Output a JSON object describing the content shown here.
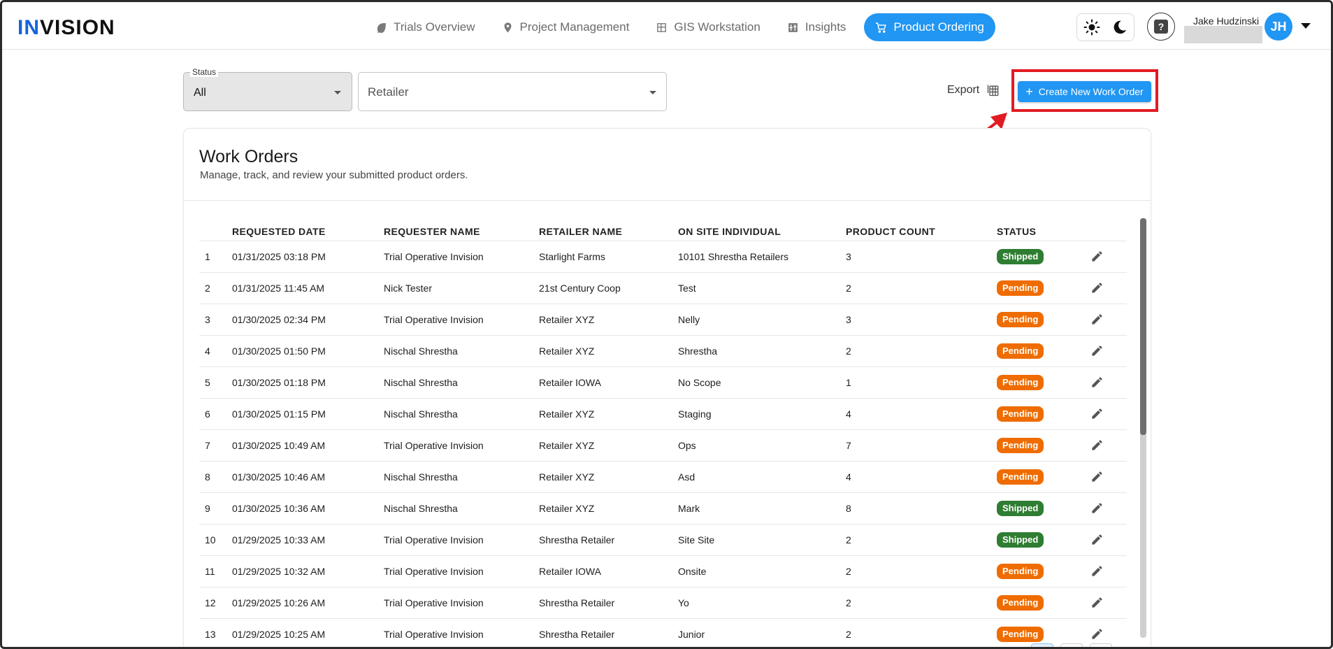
{
  "brand": {
    "logo_text": "INVISION",
    "accent": "#2196f3"
  },
  "nav": [
    {
      "label": "Trials Overview",
      "icon": "leaf-icon",
      "active": false
    },
    {
      "label": "Project Management",
      "icon": "location-settings-icon",
      "active": false
    },
    {
      "label": "GIS Workstation",
      "icon": "grid-icon",
      "active": false
    },
    {
      "label": "Insights",
      "icon": "sliders-icon",
      "active": false
    },
    {
      "label": "Product Ordering",
      "icon": "cart-icon",
      "active": true
    }
  ],
  "header": {
    "help_label": "?",
    "user_name": "Jake Hudzinski",
    "avatar_initials": "JH"
  },
  "filters": {
    "status_legend": "Status",
    "status_value": "All",
    "retailer_placeholder": "Retailer"
  },
  "actions": {
    "export_label": "Export",
    "create_label": "Create New Work Order",
    "create_plus": "+"
  },
  "card": {
    "title": "Work Orders",
    "subtitle": "Manage, track, and review your submitted product orders."
  },
  "table": {
    "columns": [
      "",
      "REQUESTED DATE",
      "REQUESTER NAME",
      "RETAILER NAME",
      "ON SITE INDIVIDUAL",
      "PRODUCT COUNT",
      "STATUS",
      ""
    ],
    "rows": [
      {
        "n": "1",
        "date": "01/31/2025 03:18 PM",
        "requester": "Trial Operative Invision",
        "retailer": "Starlight Farms",
        "onsite": "10101 Shrestha Retailers",
        "count": "3",
        "status": "Shipped"
      },
      {
        "n": "2",
        "date": "01/31/2025 11:45 AM",
        "requester": "Nick Tester",
        "retailer": "21st Century Coop",
        "onsite": "Test",
        "count": "2",
        "status": "Pending"
      },
      {
        "n": "3",
        "date": "01/30/2025 02:34 PM",
        "requester": "Trial Operative Invision",
        "retailer": "Retailer XYZ",
        "onsite": "Nelly",
        "count": "3",
        "status": "Pending"
      },
      {
        "n": "4",
        "date": "01/30/2025 01:50 PM",
        "requester": "Nischal Shrestha",
        "retailer": "Retailer XYZ",
        "onsite": "Shrestha",
        "count": "2",
        "status": "Pending"
      },
      {
        "n": "5",
        "date": "01/30/2025 01:18 PM",
        "requester": "Nischal Shrestha",
        "retailer": "Retailer IOWA",
        "onsite": "No Scope",
        "count": "1",
        "status": "Pending"
      },
      {
        "n": "6",
        "date": "01/30/2025 01:15 PM",
        "requester": "Nischal Shrestha",
        "retailer": "Retailer XYZ",
        "onsite": "Staging",
        "count": "4",
        "status": "Pending"
      },
      {
        "n": "7",
        "date": "01/30/2025 10:49 AM",
        "requester": "Trial Operative Invision",
        "retailer": "Retailer XYZ",
        "onsite": "Ops",
        "count": "7",
        "status": "Pending"
      },
      {
        "n": "8",
        "date": "01/30/2025 10:46 AM",
        "requester": "Nischal Shrestha",
        "retailer": "Retailer XYZ",
        "onsite": "Asd",
        "count": "4",
        "status": "Pending"
      },
      {
        "n": "9",
        "date": "01/30/2025 10:36 AM",
        "requester": "Nischal Shrestha",
        "retailer": "Retailer XYZ",
        "onsite": "Mark",
        "count": "8",
        "status": "Shipped"
      },
      {
        "n": "10",
        "date": "01/29/2025 10:33 AM",
        "requester": "Trial Operative Invision",
        "retailer": "Shrestha Retailer",
        "onsite": "Site Site",
        "count": "2",
        "status": "Shipped"
      },
      {
        "n": "11",
        "date": "01/29/2025 10:32 AM",
        "requester": "Trial Operative Invision",
        "retailer": "Retailer IOWA",
        "onsite": "Onsite",
        "count": "2",
        "status": "Pending"
      },
      {
        "n": "12",
        "date": "01/29/2025 10:26 AM",
        "requester": "Trial Operative Invision",
        "retailer": "Shrestha Retailer",
        "onsite": "Yo",
        "count": "2",
        "status": "Pending"
      },
      {
        "n": "13",
        "date": "01/29/2025 10:25 AM",
        "requester": "Trial Operative Invision",
        "retailer": "Shrestha Retailer",
        "onsite": "Junior",
        "count": "2",
        "status": "Pending"
      }
    ]
  },
  "colors": {
    "shipped": "#2e7d32",
    "pending": "#ef6c00",
    "highlight": "#e21b23"
  }
}
